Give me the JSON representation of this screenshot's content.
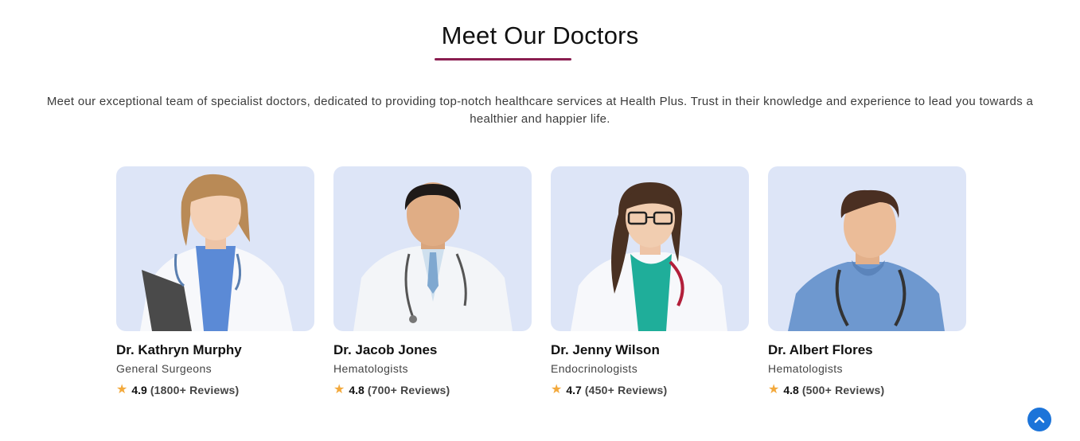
{
  "section": {
    "title": "Meet Our Doctors",
    "intro": "Meet our exceptional team of specialist doctors, dedicated to providing top-notch healthcare services at Health Plus. Trust in their knowledge and experience to lead you towards a healthier and happier life."
  },
  "doctors": [
    {
      "name": "Dr. Kathryn Murphy",
      "specialty": "General Surgeons",
      "rating": "4.9",
      "reviews": "(1800+ Reviews)"
    },
    {
      "name": "Dr. Jacob Jones",
      "specialty": "Hematologists",
      "rating": "4.8",
      "reviews": "(700+ Reviews)"
    },
    {
      "name": "Dr. Jenny Wilson",
      "specialty": "Endocrinologists",
      "rating": "4.7",
      "reviews": "(450+ Reviews)"
    },
    {
      "name": "Dr. Albert Flores",
      "specialty": "Hematologists",
      "rating": "4.8",
      "reviews": "(500+ Reviews)"
    }
  ],
  "colors": {
    "accent": "#8a1d50",
    "card_bg": "#dde5f7",
    "star": "#f3a93c",
    "scroll_button": "#1c74d9"
  },
  "icons": {
    "rating": "star-icon",
    "scroll_top": "chevron-up-icon"
  }
}
